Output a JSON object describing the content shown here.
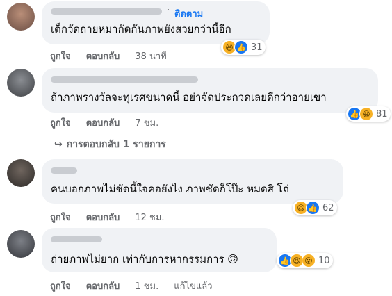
{
  "comments": [
    {
      "follow_label": "ติดตาม",
      "text": "เด็กวัดถ่ายหมากัดกันภาพยังสวยกว่านี้อีก",
      "like_label": "ถูกใจ",
      "reply_label": "ตอบกลับ",
      "time": "38 นาที",
      "reaction_count": "31",
      "reactions": [
        "haha",
        "like"
      ]
    },
    {
      "text": "ถ้าภาพรางวัลจะทุเรศขนาดนี้ อย่าจัดประกวดเลยดีกว่าอายเขา",
      "like_label": "ถูกใจ",
      "reply_label": "ตอบกลับ",
      "time": "7 ชม.",
      "reaction_count": "81",
      "reactions": [
        "like",
        "haha"
      ],
      "replies_label": "การตอบกลับ 1 รายการ"
    },
    {
      "text": "คนบอกภาพไม่ชัดนี้ใจคอยังไง ภาพชัดก็โป๊ะ หมดสิ โถ่",
      "like_label": "ถูกใจ",
      "reply_label": "ตอบกลับ",
      "time": "12 ชม.",
      "reaction_count": "62",
      "reactions": [
        "haha",
        "like"
      ]
    },
    {
      "text": "ถ่ายภาพไม่ยาก เท่ากับการหากรรมการ 🙃",
      "like_label": "ถูกใจ",
      "reply_label": "ตอบกลับ",
      "time": "1 ชม.",
      "edited_label": "แก้ไขแล้ว",
      "reaction_count": "10",
      "reactions": [
        "like",
        "haha",
        "wow"
      ]
    }
  ],
  "icons": {
    "like": "👍",
    "haha": "😆",
    "wow": "😮",
    "reply_arrow": "↪"
  }
}
